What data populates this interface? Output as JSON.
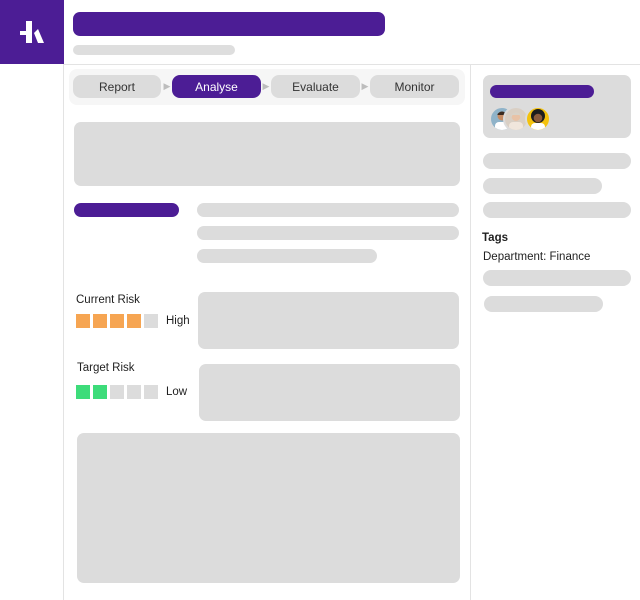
{
  "colors": {
    "brand_purple": "#4c1d95",
    "placeholder_grey": "#dcdcdc",
    "risk_orange": "#f6a552",
    "risk_green": "#3ddc7a"
  },
  "header": {
    "logo_icon": "brand-logo-icon"
  },
  "stepper": {
    "steps": [
      {
        "label": "Report",
        "active": false
      },
      {
        "label": "Analyse",
        "active": true
      },
      {
        "label": "Evaluate",
        "active": false
      },
      {
        "label": "Monitor",
        "active": false
      }
    ],
    "arrow_icon": "chevron-right-icon"
  },
  "risks": {
    "current": {
      "label": "Current Risk",
      "level": "High",
      "filled": 4,
      "total": 5,
      "color": "#f6a552"
    },
    "target": {
      "label": "Target Risk",
      "level": "Low",
      "filled": 2,
      "total": 5,
      "color": "#3ddc7a"
    }
  },
  "sidebar": {
    "owners_avatars": [
      "avatar-person-1",
      "avatar-person-2",
      "avatar-person-3"
    ],
    "tags_heading": "Tags",
    "tags": [
      "Department: Finance"
    ]
  }
}
